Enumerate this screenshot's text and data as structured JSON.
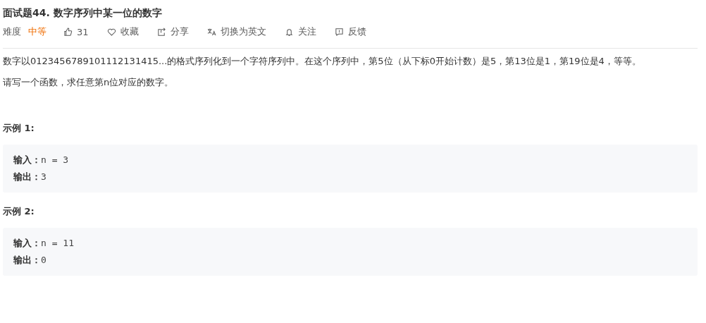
{
  "title": "面试题44. 数字序列中某一位的数字",
  "meta": {
    "difficulty_label": "难度",
    "difficulty": "中等",
    "actions": [
      {
        "kind": "like",
        "label": "31"
      },
      {
        "kind": "favorite",
        "label": "收藏"
      },
      {
        "kind": "share",
        "label": "分享"
      },
      {
        "kind": "translate",
        "label": "切换为英文"
      },
      {
        "kind": "bell",
        "label": "关注"
      },
      {
        "kind": "feedback",
        "label": "反馈"
      }
    ]
  },
  "description": [
    "数字以0123456789101112131415...的格式序列化到一个字符序列中。在这个序列中，第5位（从下标0开始计数）是5，第13位是1，第19位是4，等等。",
    "请写一个函数，求任意第n位对应的数字。"
  ],
  "examples": [
    {
      "heading": "示例 1:",
      "lines": [
        {
          "label": "输入：",
          "value": "n = 3"
        },
        {
          "label": "输出：",
          "value": "3"
        }
      ]
    },
    {
      "heading": "示例 2:",
      "lines": [
        {
          "label": "输入：",
          "value": "n = 11"
        },
        {
          "label": "输出：",
          "value": "0"
        }
      ]
    }
  ]
}
